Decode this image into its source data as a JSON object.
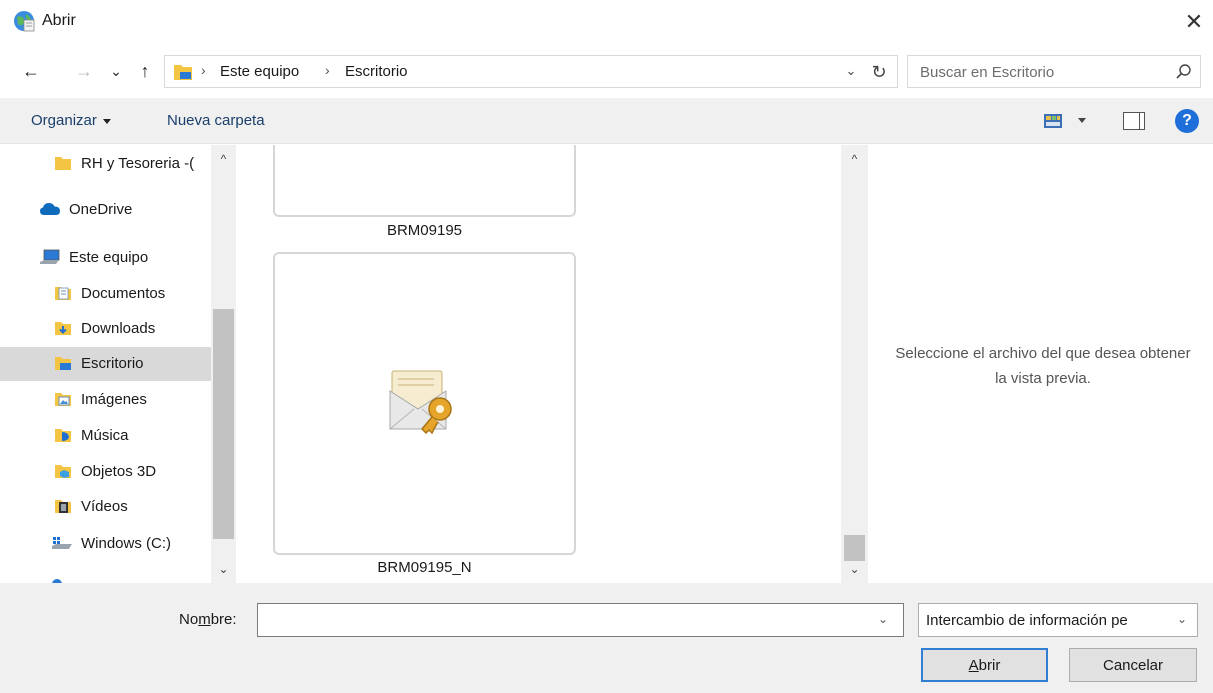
{
  "window": {
    "title": "Abrir",
    "close_glyph": "✕"
  },
  "navigation": {
    "back_glyph": "←",
    "forward_glyph": "→",
    "recent_glyph": "⌄",
    "up_glyph": "↑"
  },
  "address": {
    "breadcrumbs": [
      "Este equipo",
      "Escritorio"
    ],
    "separator": "›",
    "dropdown_glyph": "⌄",
    "refresh_glyph": "↻"
  },
  "search": {
    "placeholder": "Buscar en Escritorio"
  },
  "toolbar": {
    "organize_label": "Organizar",
    "new_folder_label": "Nueva carpeta",
    "help_label": "?"
  },
  "sidebar": {
    "scroll_up_glyph": "^",
    "scroll_down_glyph": "⌄",
    "items": [
      {
        "label": "RH y Tesoreria -(",
        "icon": "folder-icon"
      },
      {
        "label": "OneDrive",
        "icon": "cloud-icon"
      },
      {
        "label": "Este equipo",
        "icon": "computer-icon"
      },
      {
        "label": "Documentos",
        "icon": "documents-icon"
      },
      {
        "label": "Downloads",
        "icon": "downloads-icon"
      },
      {
        "label": "Escritorio",
        "icon": "desktop-icon",
        "selected": true
      },
      {
        "label": "Imágenes",
        "icon": "pictures-icon"
      },
      {
        "label": "Música",
        "icon": "music-icon"
      },
      {
        "label": "Objetos 3D",
        "icon": "objects-3d-icon"
      },
      {
        "label": "Vídeos",
        "icon": "videos-icon"
      },
      {
        "label": "Windows (C:)",
        "icon": "drive-icon"
      }
    ]
  },
  "files": [
    {
      "name": "BRM09195",
      "icon": "certificate-file-icon"
    },
    {
      "name": "BRM09195_N",
      "icon": "certificate-file-icon"
    }
  ],
  "content_scroll": {
    "up_glyph": "^",
    "down_glyph": "⌄"
  },
  "preview": {
    "message": "Seleccione el archivo del que desea obtener la vista previa."
  },
  "footer": {
    "name_label_pre": "No",
    "name_label_accel": "m",
    "name_label_post": "bre:",
    "name_value": "",
    "name_dd_glyph": "⌄",
    "filter_value": "Intercambio de información pe",
    "filter_dd_glyph": "⌄",
    "open_accel": "A",
    "open_rest": "brir",
    "cancel_label": "Cancelar"
  },
  "colors": {
    "accent": "#2f7fd3",
    "folder": "#f4c542",
    "selected": "#d9d9d9",
    "chrome": "#f0f0f0"
  }
}
